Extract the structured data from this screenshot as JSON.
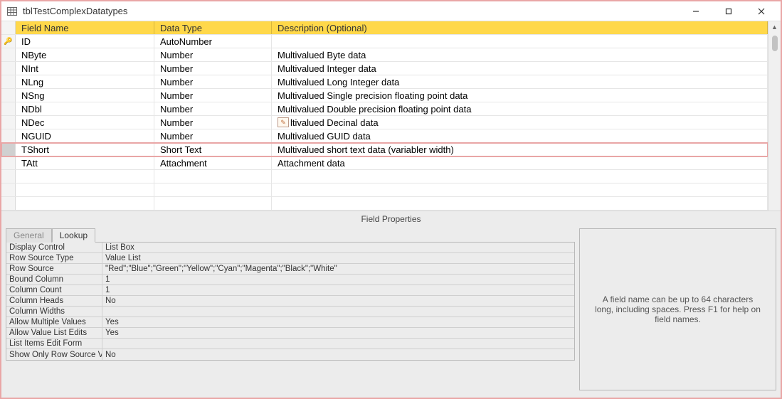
{
  "window": {
    "title": "tblTestComplexDatatypes"
  },
  "grid": {
    "headers": {
      "field_name": "Field Name",
      "data_type": "Data Type",
      "description": "Description (Optional)"
    },
    "rows": [
      {
        "pk": true,
        "field": "ID",
        "type": "AutoNumber",
        "desc": ""
      },
      {
        "pk": false,
        "field": "NByte",
        "type": "Number",
        "desc": "Multivalued Byte data"
      },
      {
        "pk": false,
        "field": "NInt",
        "type": "Number",
        "desc": "Multivalued Integer data"
      },
      {
        "pk": false,
        "field": "NLng",
        "type": "Number",
        "desc": "Multivalued Long Integer data"
      },
      {
        "pk": false,
        "field": "NSng",
        "type": "Number",
        "desc": "Multivalued Single precision floating point data"
      },
      {
        "pk": false,
        "field": "NDbl",
        "type": "Number",
        "desc": "Multivalued Double precision floating point data"
      },
      {
        "pk": false,
        "field": "NDec",
        "type": "Number",
        "desc": "ltivalued Decinal data",
        "desc_has_icon": true
      },
      {
        "pk": false,
        "field": "NGUID",
        "type": "Number",
        "desc": "Multivalued GUID data"
      },
      {
        "pk": false,
        "field": "TShort",
        "type": "Short Text",
        "desc": "Multivalued short text data (variabler width)",
        "selected": true
      },
      {
        "pk": false,
        "field": "TAtt",
        "type": "Attachment",
        "desc": "Attachment data"
      },
      {
        "pk": false,
        "field": "",
        "type": "",
        "desc": ""
      },
      {
        "pk": false,
        "field": "",
        "type": "",
        "desc": ""
      },
      {
        "pk": false,
        "field": "",
        "type": "",
        "desc": ""
      }
    ]
  },
  "field_properties": {
    "heading": "Field Properties",
    "tabs": {
      "general": "General",
      "lookup": "Lookup"
    },
    "active_tab": "lookup",
    "props": [
      {
        "label": "Display Control",
        "value": "List Box"
      },
      {
        "label": "Row Source Type",
        "value": "Value List"
      },
      {
        "label": "Row Source",
        "value": "\"Red\";\"Blue\";\"Green\";\"Yellow\";\"Cyan\";\"Magenta\";\"Black\";\"White\""
      },
      {
        "label": "Bound Column",
        "value": "1"
      },
      {
        "label": "Column Count",
        "value": "1"
      },
      {
        "label": "Column Heads",
        "value": "No"
      },
      {
        "label": "Column Widths",
        "value": ""
      },
      {
        "label": "Allow Multiple Values",
        "value": "Yes"
      },
      {
        "label": "Allow Value List Edits",
        "value": "Yes"
      },
      {
        "label": "List Items Edit Form",
        "value": ""
      },
      {
        "label": "Show Only Row Source V",
        "value": "No"
      }
    ],
    "help_text": "A field name can be up to 64 characters long, including spaces. Press F1 for help on field names."
  }
}
